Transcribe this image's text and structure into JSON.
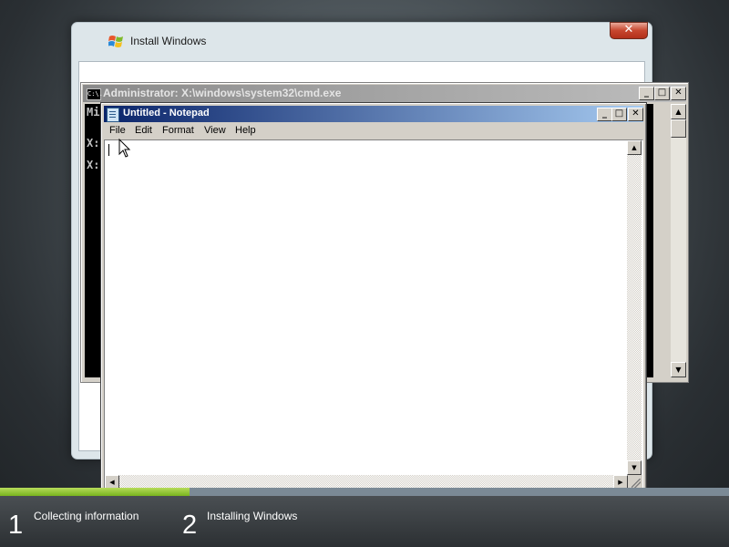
{
  "install_dialog": {
    "title": "Install Windows",
    "close_glyph": "✕"
  },
  "cmd_window": {
    "title": "Administrator: X:\\windows\\system32\\cmd.exe",
    "icon_text": "C:\\.",
    "lines": [
      "Mi",
      "X:",
      "X:"
    ],
    "buttons": {
      "minimize": "_",
      "maximize": "□",
      "close": "✕"
    }
  },
  "notepad": {
    "title": "Untitled - Notepad",
    "menu": [
      "File",
      "Edit",
      "Format",
      "View",
      "Help"
    ],
    "content": "",
    "buttons": {
      "minimize": "_",
      "maximize": "□",
      "close": "✕"
    }
  },
  "setup_progress": {
    "fill_fraction": 0.26,
    "fill_color": "#8ec63f",
    "steps": [
      {
        "number": "1",
        "label": "Collecting information"
      },
      {
        "number": "2",
        "label": "Installing Windows"
      }
    ]
  },
  "icons": [
    "windows-flag-icon",
    "cmd-icon",
    "notepad-icon",
    "mouse-pointer-icon"
  ]
}
